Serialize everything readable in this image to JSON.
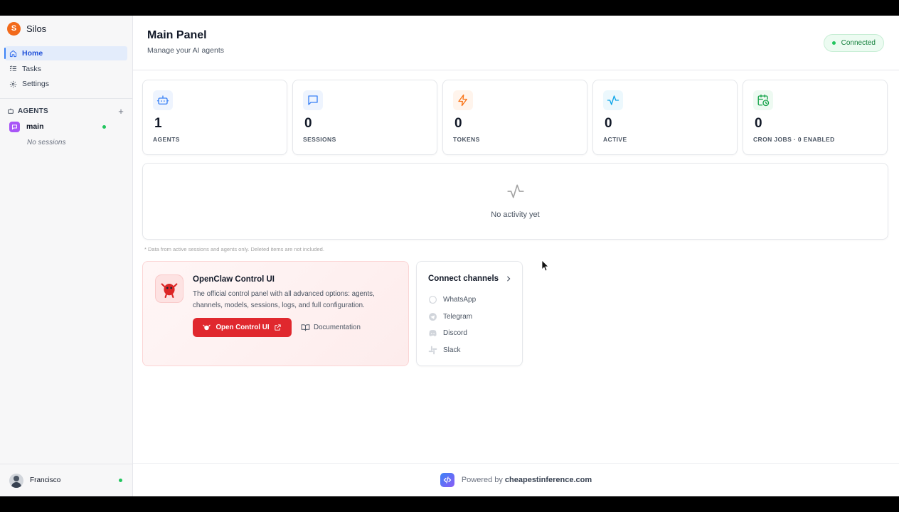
{
  "sidebar": {
    "brand_initial": "S",
    "brand_name": "Silos",
    "nav": [
      {
        "label": "Home",
        "icon": "home-icon",
        "active": true
      },
      {
        "label": "Tasks",
        "icon": "tasks-icon",
        "active": false
      },
      {
        "label": "Settings",
        "icon": "gear-icon",
        "active": false
      }
    ],
    "agents_section": {
      "title": "AGENTS",
      "add": "+",
      "agents": [
        {
          "name": "main",
          "status_color": "#22c55e"
        }
      ],
      "empty_sessions": "No sessions"
    },
    "user": {
      "name": "Francisco",
      "status_color": "#22c55e"
    }
  },
  "header": {
    "title": "Main Panel",
    "subtitle": "Manage your AI agents",
    "status_badge": "Connected"
  },
  "stats": [
    {
      "value": "1",
      "label": "AGENTS",
      "icon": "robot-icon",
      "color": "#3b82f6",
      "bg": "#eef4fe"
    },
    {
      "value": "0",
      "label": "SESSIONS",
      "icon": "message-icon",
      "color": "#3b82f6",
      "bg": "#eef4fe"
    },
    {
      "value": "0",
      "label": "TOKENS",
      "icon": "lightning-icon",
      "color": "#f97316",
      "bg": "#fff4ec"
    },
    {
      "value": "0",
      "label": "ACTIVE",
      "icon": "activity-icon",
      "color": "#0ea5e9",
      "bg": "#ecf8fd"
    },
    {
      "value": "0",
      "label": "CRON JOBS · 0 ENABLED",
      "icon": "calendar-clock-icon",
      "color": "#16a34a",
      "bg": "#eefaf2"
    }
  ],
  "activity": {
    "empty_text": "No activity yet"
  },
  "footnote": "* Data from active sessions and agents only. Deleted items are not included.",
  "openclaw": {
    "title": "OpenClaw Control UI",
    "description": "The official control panel with all advanced options: agents, channels, models, sessions, logs, and full configuration.",
    "open_button": "Open Control UI",
    "docs_link": "Documentation",
    "accent": "#e0282e"
  },
  "channels": {
    "title": "Connect channels",
    "items": [
      {
        "label": "WhatsApp",
        "icon": "whatsapp-icon"
      },
      {
        "label": "Telegram",
        "icon": "telegram-icon"
      },
      {
        "label": "Discord",
        "icon": "discord-icon"
      },
      {
        "label": "Slack",
        "icon": "slack-icon"
      }
    ]
  },
  "footer": {
    "prefix": "Powered by",
    "brand": "cheapestinference.com"
  }
}
